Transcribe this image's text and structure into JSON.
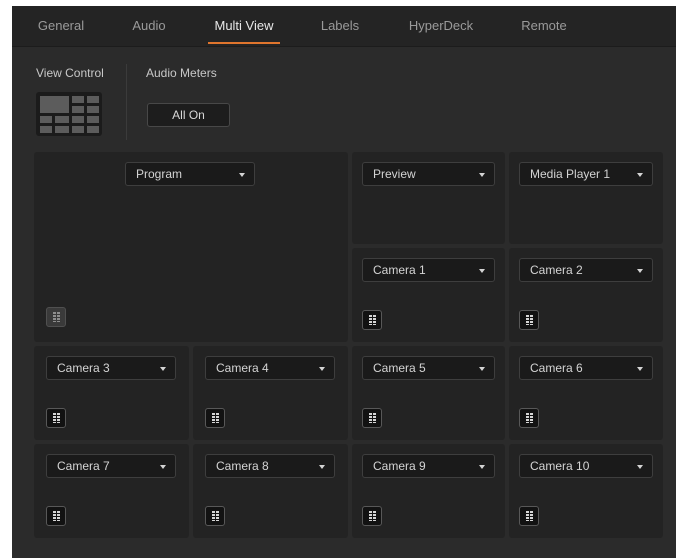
{
  "tabs": [
    "General",
    "Audio",
    "Multi View",
    "Labels",
    "HyperDeck",
    "Remote"
  ],
  "active_tab": "Multi View",
  "accent_color": "#e0752d",
  "view_control": {
    "label": "View Control"
  },
  "audio_meters": {
    "label": "Audio Meters",
    "button_label": "All On"
  },
  "windows": {
    "program": {
      "selected": "Program",
      "meter_on": false
    },
    "preview": {
      "selected": "Preview"
    },
    "media_player_1": {
      "selected": "Media Player 1"
    },
    "camera_1": {
      "selected": "Camera 1",
      "meter_on": true
    },
    "camera_2": {
      "selected": "Camera 2",
      "meter_on": true
    },
    "camera_3": {
      "selected": "Camera 3",
      "meter_on": true
    },
    "camera_4": {
      "selected": "Camera 4",
      "meter_on": true
    },
    "camera_5": {
      "selected": "Camera 5",
      "meter_on": true
    },
    "camera_6": {
      "selected": "Camera 6",
      "meter_on": true
    },
    "camera_7": {
      "selected": "Camera 7",
      "meter_on": true
    },
    "camera_8": {
      "selected": "Camera 8",
      "meter_on": true
    },
    "camera_9": {
      "selected": "Camera 9",
      "meter_on": true
    },
    "camera_10": {
      "selected": "Camera 10",
      "meter_on": true
    }
  }
}
